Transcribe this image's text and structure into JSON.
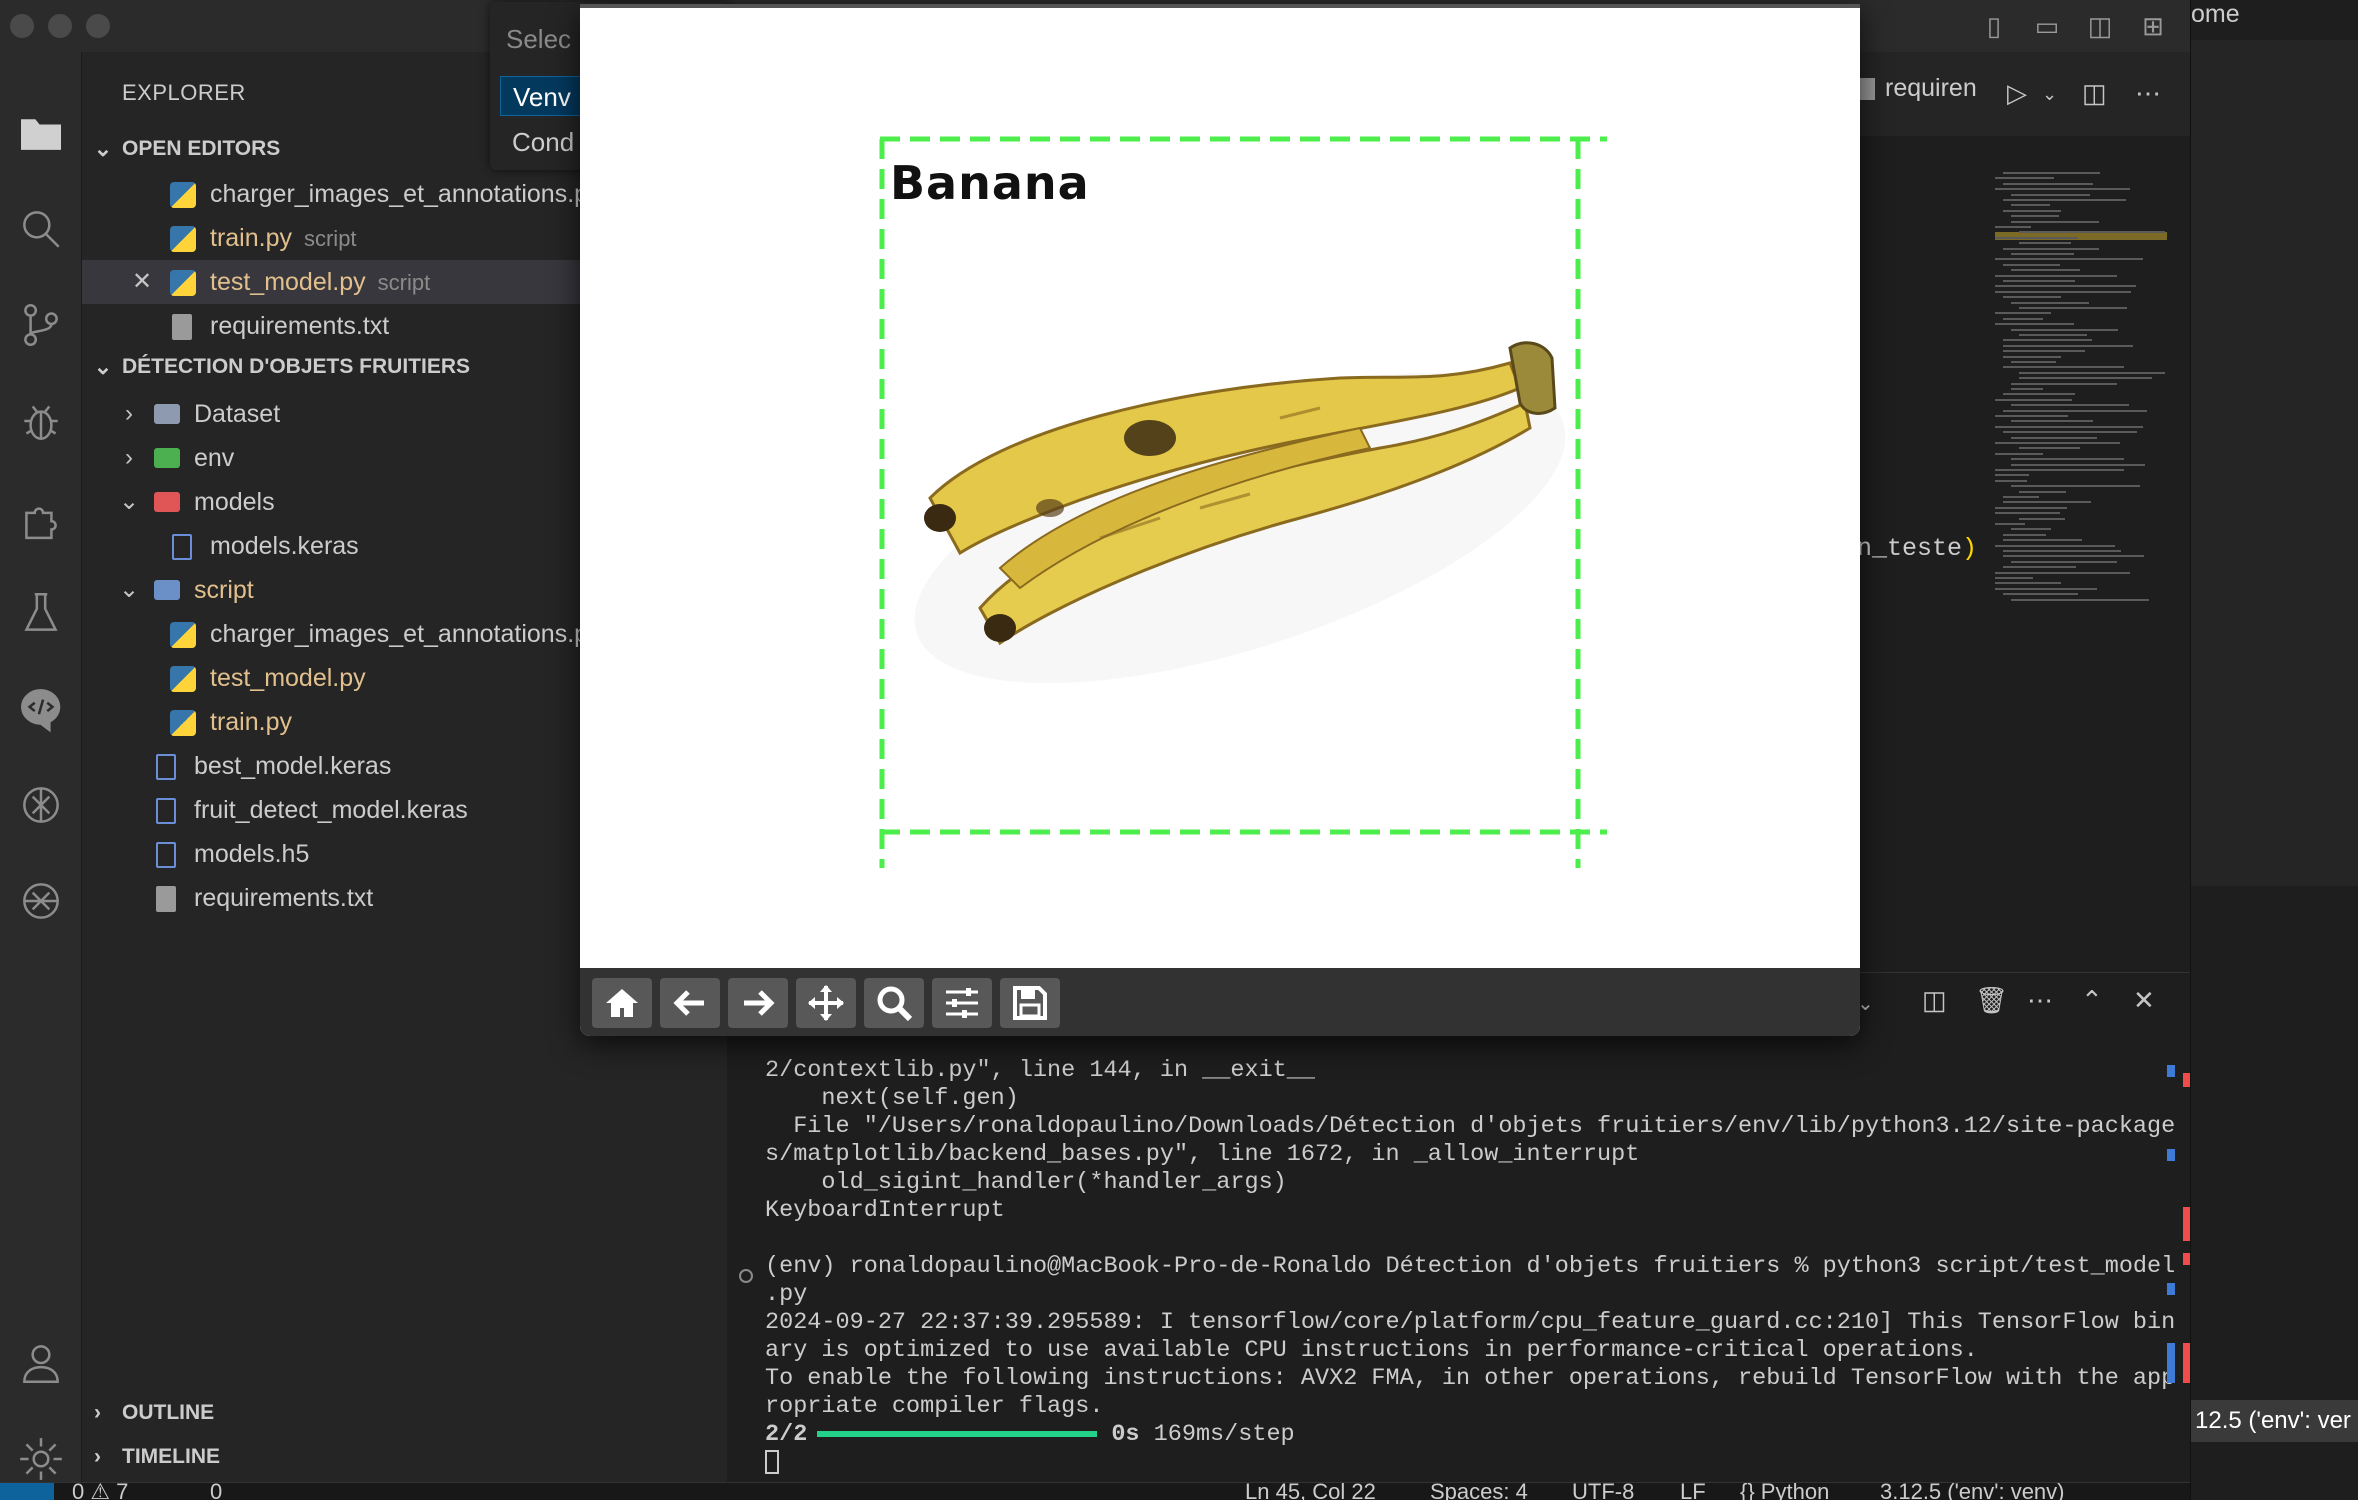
{
  "sidebar": {
    "title": "EXPLORER",
    "open_editors": {
      "header": "OPEN EDITORS",
      "items": [
        {
          "name": "charger_images_et_annotations.py",
          "desc": ""
        },
        {
          "name": "train.py",
          "desc": "script"
        },
        {
          "name": "test_model.py",
          "desc": "script"
        },
        {
          "name": "requirements.txt",
          "desc": ""
        }
      ]
    },
    "project": {
      "header": "DÉTECTION D'OBJETS FRUITIERS",
      "items": [
        {
          "name": "Dataset"
        },
        {
          "name": "env"
        },
        {
          "name": "models"
        },
        {
          "name": "models.keras"
        },
        {
          "name": "script"
        },
        {
          "name": "charger_images_et_annotations.py"
        },
        {
          "name": "test_model.py"
        },
        {
          "name": "train.py"
        },
        {
          "name": "best_model.keras"
        },
        {
          "name": "fruit_detect_model.keras"
        },
        {
          "name": "models.h5"
        },
        {
          "name": "requirements.txt"
        }
      ]
    },
    "outline": "OUTLINE",
    "timeline": "TIMELINE"
  },
  "quickpick": {
    "placeholder": "Selec",
    "items": [
      "Venv",
      "Cond"
    ]
  },
  "editor": {
    "tab_label": "requiren",
    "code_fragment": "n_teste",
    "code_paren": ")"
  },
  "rightwin": {
    "title": "ome",
    "status": "12.5 ('env': ver"
  },
  "plot": {
    "label": "Banana",
    "box_color": "#4cee4c"
  },
  "terminal": {
    "lines": [
      "2/contextlib.py\", line 144, in __exit__",
      "    next(self.gen)",
      "  File \"/Users/ronaldopaulino/Downloads/Détection d'objets fruitiers/env/lib/python3.12/site-package",
      "s/matplotlib/backend_bases.py\", line 1672, in _allow_interrupt",
      "    old_sigint_handler(*handler_args)",
      "KeyboardInterrupt",
      "",
      "(env) ronaldopaulino@MacBook-Pro-de-Ronaldo Détection d'objets fruitiers % python3 script/test_model",
      ".py",
      "2024-09-27 22:37:39.295589: I tensorflow/core/platform/cpu_feature_guard.cc:210] This TensorFlow bin",
      "ary is optimized to use available CPU instructions in performance-critical operations.",
      "To enable the following instructions: AVX2 FMA, in other operations, rebuild TensorFlow with the app",
      "ropriate compiler flags."
    ],
    "progress_step": "2/2",
    "progress_fraction": 1.0,
    "progress_time": "0s",
    "progress_rate": "169ms/step"
  },
  "statusbar": {
    "problems": "0 ⚠ 7",
    "ports": "0",
    "position": "Ln 45, Col 22",
    "spaces": "Spaces: 4",
    "encoding": "UTF-8",
    "eol": "LF",
    "language": "{} Python",
    "interpreter": "3.12.5 ('env': venv)"
  },
  "colors": {
    "accent": "#0e639c",
    "modified": "#e2c08d",
    "progress": "#23d18b"
  }
}
